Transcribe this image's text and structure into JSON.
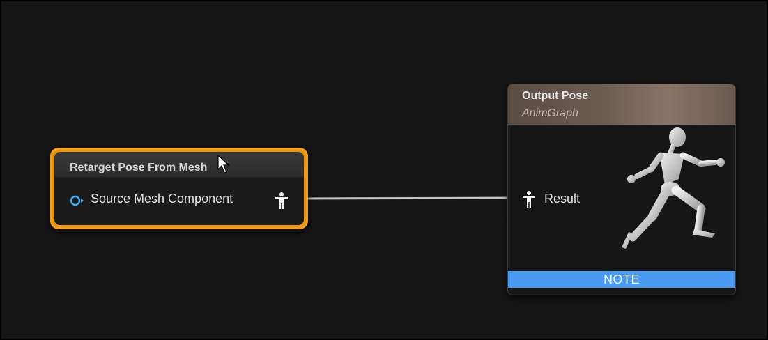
{
  "retarget_node": {
    "title": "Retarget Pose From Mesh",
    "input_pin_label": "Source Mesh Component",
    "input_pin_icon": "object-pin-icon",
    "output_pin_icon": "pose-pin-icon"
  },
  "output_node": {
    "title": "Output Pose",
    "subtitle": "AnimGraph",
    "input_pin_label": "Result",
    "input_pin_icon": "pose-pin-icon",
    "footer_label": "NOTE",
    "preview_icon": "running-mannequin-icon"
  },
  "colors": {
    "graph_background": "#262626",
    "selected_border": "#f0a020",
    "object_pin": "#3ea8f5",
    "note_bar": "#4a9af2"
  }
}
